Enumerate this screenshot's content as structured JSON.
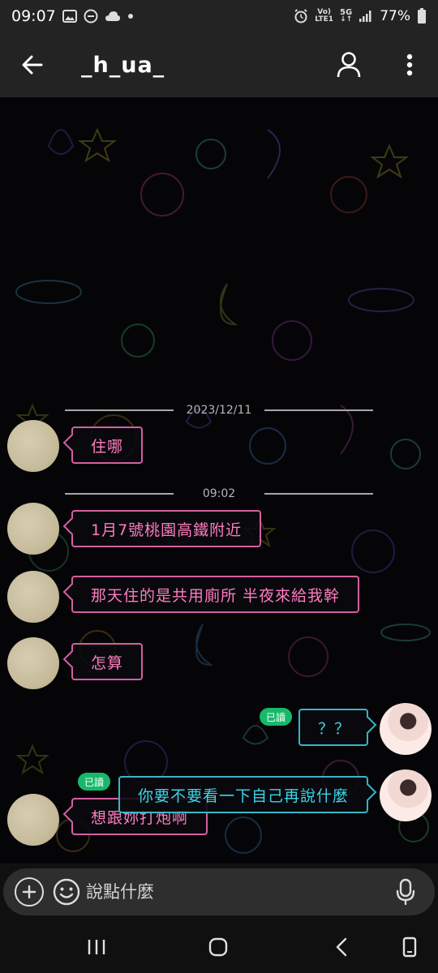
{
  "status_bar": {
    "time": "09:07",
    "network_top": "Vo)",
    "network_bottom": "LTE1",
    "gen_label": "5G",
    "battery": "77%"
  },
  "header": {
    "title": "_h_ua_"
  },
  "chat": {
    "dividers": [
      {
        "label": "2023/12/11"
      },
      {
        "label": "09:02"
      }
    ],
    "messages": [
      {
        "from": "other",
        "text": "住哪"
      },
      {
        "from": "other",
        "text": "1月7號桃園高鐵附近"
      },
      {
        "from": "other",
        "text": "那天住的是共用廁所 半夜來給我幹"
      },
      {
        "from": "other",
        "text": "怎算"
      },
      {
        "from": "self",
        "text": "？？",
        "status": "已讀"
      },
      {
        "from": "self",
        "text": "你要不要看一下自己再說什麼",
        "status": "已讀"
      },
      {
        "from": "other",
        "text": "想跟妳打炮啊"
      }
    ]
  },
  "input": {
    "placeholder": "說點什麼"
  },
  "colors": {
    "incoming_border": "#d65fa1",
    "incoming_text": "#ff7cc1",
    "outgoing_border": "#36b6c7",
    "outgoing_text": "#3ad6e8",
    "read_badge": "#17b86a",
    "bar_bg": "#232323"
  },
  "icons": [
    "back-arrow-icon",
    "profile-icon",
    "more-vert-icon",
    "plus-icon",
    "emoji-icon",
    "mic-icon",
    "recents-icon",
    "home-icon",
    "nav-back-icon",
    "screenshot-icon"
  ]
}
